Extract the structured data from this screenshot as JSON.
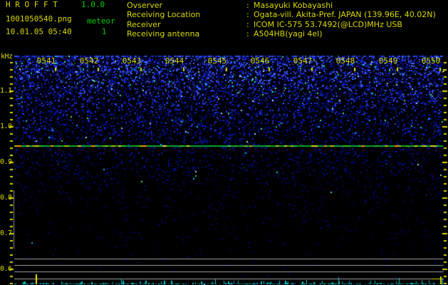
{
  "header": {
    "app_title": "H R O F F T",
    "version": "1.0.0",
    "filename": "1001050540.png",
    "counter_label": "meteor",
    "counter_value": "1",
    "datetime": "10.01.05 05:40",
    "colon": ":",
    "info": [
      {
        "label": "Ovserver",
        "value": "Masayuki Kobayashi"
      },
      {
        "label": "Receiving Location",
        "value": "Ogata-vill. Akita-Pref. JAPAN (139.96E, 40.02N)"
      },
      {
        "label": "Receiver",
        "value": "ICOM IC-575 53.7492(@LCD)MHz USB"
      },
      {
        "label": "Receiving antenna",
        "value": "A504HB(yagi 4el)"
      }
    ]
  },
  "spectrogram": {
    "y_axis_unit": "kHz",
    "freq_labels": [
      "1.1",
      "1.0",
      "0.9",
      "0.8",
      "0.7",
      "0.6"
    ],
    "time_labels": [
      "0541",
      "0542",
      "0543",
      "0544",
      "0545",
      "0546",
      "0547",
      "0548",
      "0549",
      "0550"
    ]
  },
  "chart_data": {
    "type": "heatmap",
    "title": "HROFFT 1.0.0 radio meteor echo spectrogram, 10.01.05 05:40-05:50",
    "x_ticks": [
      "0541",
      "0542",
      "0543",
      "0544",
      "0545",
      "0546",
      "0547",
      "0548",
      "0549",
      "0550"
    ],
    "x_axis": "time (HHMM), 1-minute intervals over 10 minutes",
    "ylabel": "kHz",
    "y_ticks": [
      1.1,
      1.0,
      0.9,
      0.8,
      0.7,
      0.6
    ],
    "y_range_khz": [
      0.56,
      1.2
    ],
    "carrier_line_khz": 0.95,
    "meteor_count": 1,
    "noise_profile": "dense blue speckle noise at top (1.0-1.2 kHz) fading to near-black below 0.8 kHz",
    "carrier_line": "continuous green/yellow horizontal carrier trace at ~0.95 kHz across full width",
    "level_plot": "bottom strip with 4 gray horizontal gridlines and cyan signal-level trace; yellow meteor spike near 0541 and at right edge",
    "colors": {
      "accent_yellow": "#d8d800",
      "accent_green": "#00cc00",
      "carrier_green": "#00a830",
      "grid_gray": "#a0a0a0",
      "trace_cyan": "#00c4c4",
      "noise_blue": "#2a3cf0"
    }
  }
}
